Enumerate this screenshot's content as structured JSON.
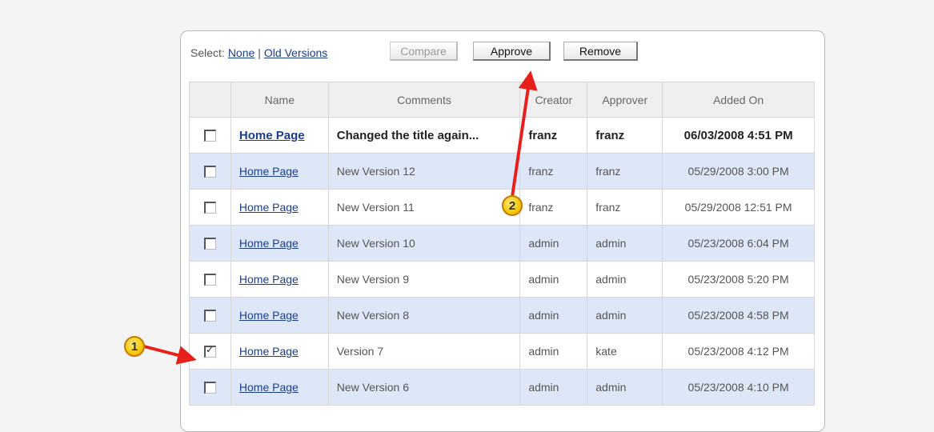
{
  "toolbar": {
    "select_label": "Select:",
    "none_link": "None",
    "separator": "|",
    "old_versions_link": "Old Versions",
    "compare_label": "Compare",
    "approve_label": "Approve",
    "remove_label": "Remove"
  },
  "table": {
    "headers": [
      "",
      "Name",
      "Comments",
      "Creator",
      "Approver",
      "Added On"
    ],
    "rows": [
      {
        "checked": false,
        "name": "Home Page",
        "comment": "Changed the title again...",
        "creator": "franz",
        "approver": "franz",
        "added_on": "06/03/2008 4:51 PM"
      },
      {
        "checked": false,
        "name": "Home Page",
        "comment": "New Version 12",
        "creator": "franz",
        "approver": "franz",
        "added_on": "05/29/2008 3:00 PM"
      },
      {
        "checked": false,
        "name": "Home Page",
        "comment": "New Version 11",
        "creator": "franz",
        "approver": "franz",
        "added_on": "05/29/2008 12:51 PM"
      },
      {
        "checked": false,
        "name": "Home Page",
        "comment": "New Version 10",
        "creator": "admin",
        "approver": "admin",
        "added_on": "05/23/2008 6:04 PM"
      },
      {
        "checked": false,
        "name": "Home Page",
        "comment": "New Version 9",
        "creator": "admin",
        "approver": "admin",
        "added_on": "05/23/2008 5:20 PM"
      },
      {
        "checked": false,
        "name": "Home Page",
        "comment": "New Version 8",
        "creator": "admin",
        "approver": "admin",
        "added_on": "05/23/2008 4:58 PM"
      },
      {
        "checked": true,
        "name": "Home Page",
        "comment": "Version 7",
        "creator": "admin",
        "approver": "kate",
        "added_on": "05/23/2008 4:12 PM"
      },
      {
        "checked": false,
        "name": "Home Page",
        "comment": "New Version 6",
        "creator": "admin",
        "approver": "admin",
        "added_on": "05/23/2008 4:10 PM"
      }
    ]
  },
  "annotations": {
    "marker1": "1",
    "marker2": "2",
    "arrow_color": "#e8201c"
  }
}
